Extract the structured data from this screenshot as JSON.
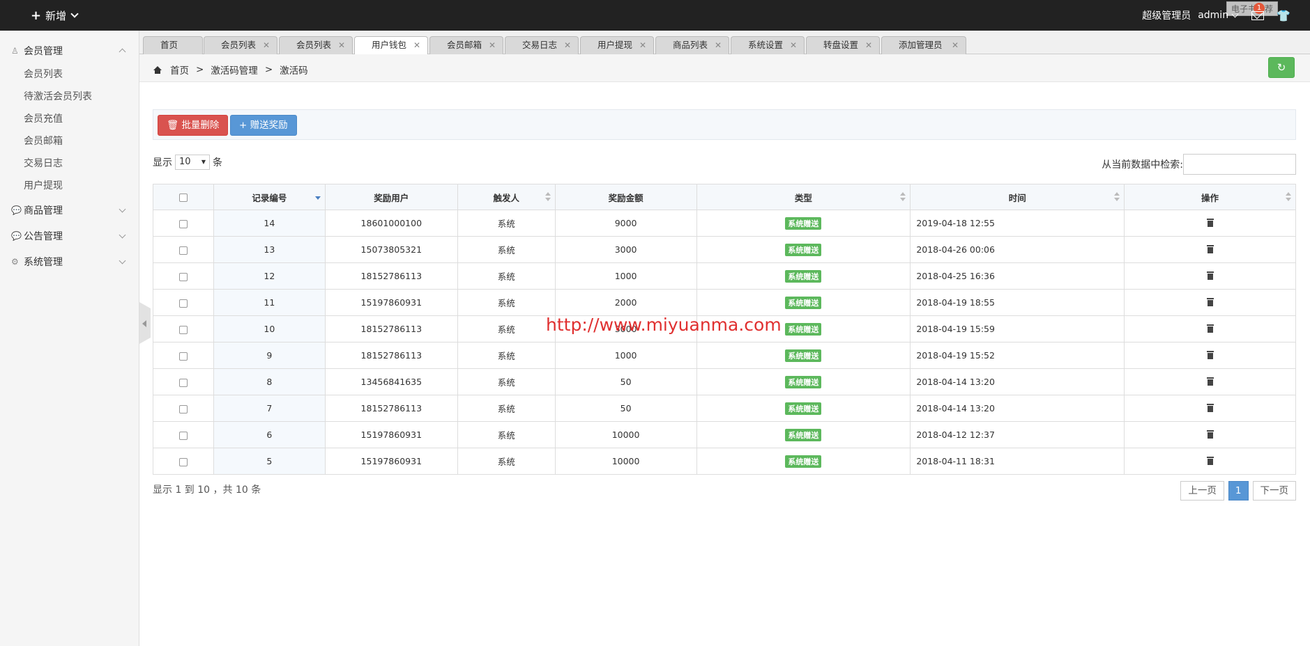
{
  "topbar": {
    "new_label": "新增",
    "role": "超级管理员",
    "user": "admin",
    "tooltip": "电子书推荐",
    "badge": "1"
  },
  "sidebar": {
    "groups": [
      {
        "label": "会员管理",
        "icon": "user-icon",
        "items": [
          "会员列表",
          "待激活会员列表",
          "会员充值",
          "会员邮箱",
          "交易日志",
          "用户提现"
        ]
      },
      {
        "label": "商品管理",
        "icon": "comment-icon"
      },
      {
        "label": "公告管理",
        "icon": "comment-icon"
      },
      {
        "label": "系统管理",
        "icon": "gear-icon"
      }
    ]
  },
  "tabs": [
    "首页",
    "会员列表",
    "会员列表",
    "用户钱包",
    "会员邮箱",
    "交易日志",
    "用户提现",
    "商品列表",
    "系统设置",
    "转盘设置",
    "添加管理员"
  ],
  "active_tab": "用户钱包",
  "breadcrumb": [
    "首页",
    ">",
    "激活码管理",
    ">",
    "激活码"
  ],
  "toolbar": {
    "delete_label": "批量删除",
    "reward_label": "赠送奖励"
  },
  "length": {
    "prefix": "显示",
    "value": "10",
    "suffix": "条"
  },
  "search": {
    "label": "从当前数据中检索:"
  },
  "table": {
    "headers": [
      "记录编号",
      "奖励用户",
      "触发人",
      "奖励金额",
      "类型",
      "时间",
      "操作"
    ],
    "rows": [
      {
        "id": "14",
        "user": "18601000100",
        "trigger": "系统",
        "amount": "9000",
        "type": "系统赠送",
        "time": "2019-04-18 12:55"
      },
      {
        "id": "13",
        "user": "15073805321",
        "trigger": "系统",
        "amount": "3000",
        "type": "系统赠送",
        "time": "2018-04-26 00:06"
      },
      {
        "id": "12",
        "user": "18152786113",
        "trigger": "系统",
        "amount": "1000",
        "type": "系统赠送",
        "time": "2018-04-25 16:36"
      },
      {
        "id": "11",
        "user": "15197860931",
        "trigger": "系统",
        "amount": "2000",
        "type": "系统赠送",
        "time": "2018-04-19 18:55"
      },
      {
        "id": "10",
        "user": "18152786113",
        "trigger": "系统",
        "amount": "3000",
        "type": "系统赠送",
        "time": "2018-04-19 15:59"
      },
      {
        "id": "9",
        "user": "18152786113",
        "trigger": "系统",
        "amount": "1000",
        "type": "系统赠送",
        "time": "2018-04-19 15:52"
      },
      {
        "id": "8",
        "user": "13456841635",
        "trigger": "系统",
        "amount": "50",
        "type": "系统赠送",
        "time": "2018-04-14 13:20"
      },
      {
        "id": "7",
        "user": "18152786113",
        "trigger": "系统",
        "amount": "50",
        "type": "系统赠送",
        "time": "2018-04-14 13:20"
      },
      {
        "id": "6",
        "user": "15197860931",
        "trigger": "系统",
        "amount": "10000",
        "type": "系统赠送",
        "time": "2018-04-12 12:37"
      },
      {
        "id": "5",
        "user": "15197860931",
        "trigger": "系统",
        "amount": "10000",
        "type": "系统赠送",
        "time": "2018-04-11 18:31"
      }
    ]
  },
  "watermark": "http://www.miyuanma.com",
  "info": "显示 1 到 10 ，共 10 条",
  "pager": {
    "prev": "上一页",
    "current": "1",
    "next": "下一页"
  },
  "colors": {
    "topbar": "#222222",
    "danger": "#d9534f",
    "primary": "#5897d6",
    "success": "#5cb85c"
  }
}
